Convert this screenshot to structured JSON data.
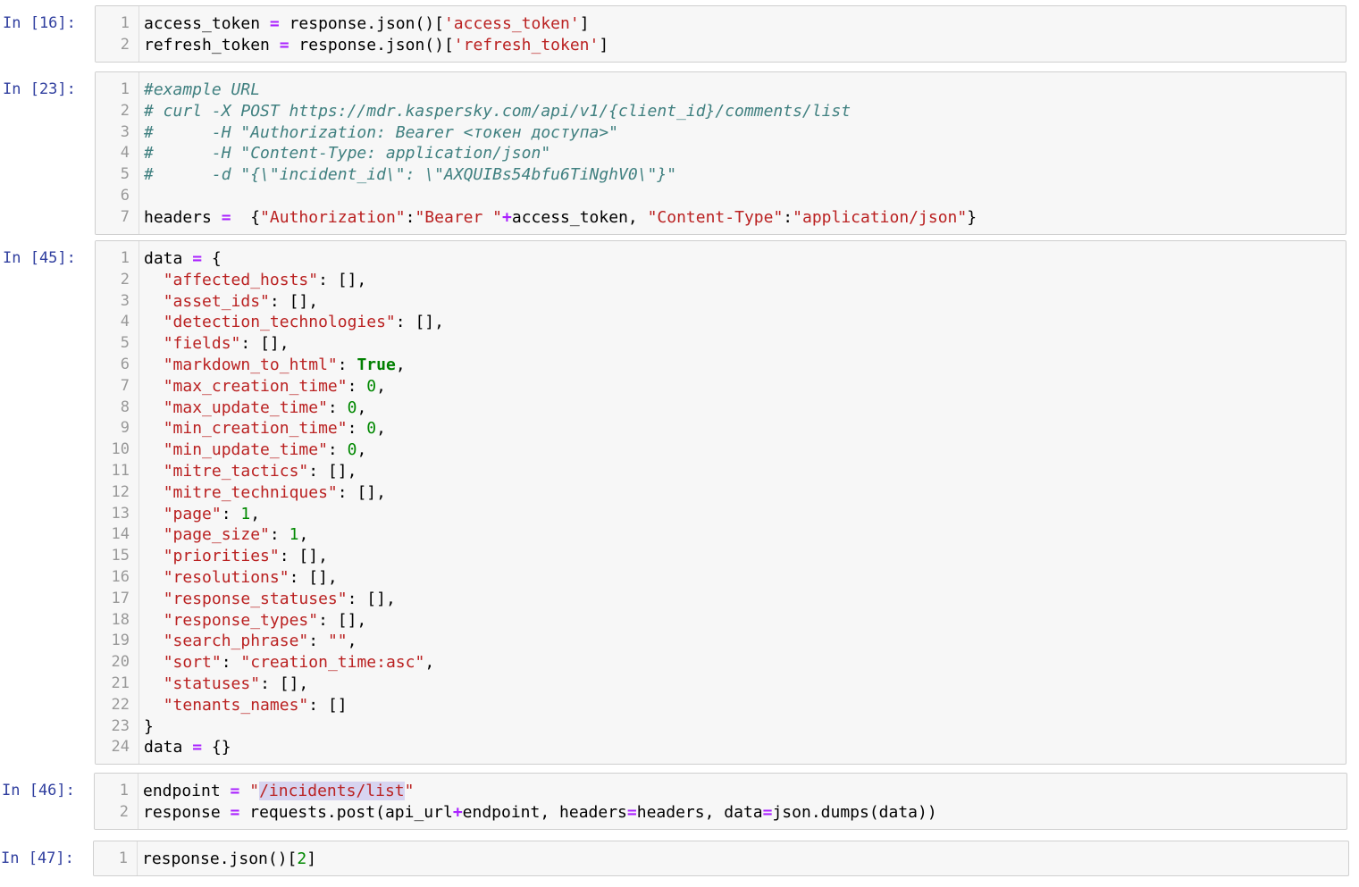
{
  "cells": [
    {
      "prompt": "In [16]:",
      "lines": [
        [
          [
            "t",
            "access_token "
          ],
          [
            "o",
            "="
          ],
          [
            "t",
            " response.json()["
          ],
          [
            "s",
            "'access_token'"
          ],
          [
            "t",
            "]"
          ]
        ],
        [
          [
            "t",
            "refresh_token "
          ],
          [
            "o",
            "="
          ],
          [
            "t",
            " response.json()["
          ],
          [
            "s",
            "'refresh_token'"
          ],
          [
            "t",
            "]"
          ]
        ]
      ]
    },
    {
      "prompt": "In [23]:",
      "lines": [
        [
          [
            "c",
            "#example URL"
          ]
        ],
        [
          [
            "c",
            "# curl -X POST https://mdr.kaspersky.com/api/v1/{client_id}/comments/list"
          ]
        ],
        [
          [
            "c",
            "#      -H \"Authorization: Bearer <токен доступа>\""
          ]
        ],
        [
          [
            "c",
            "#      -H \"Content-Type: application/json\""
          ]
        ],
        [
          [
            "c",
            "#      -d \"{\\\"incident_id\\\": \\\"AXQUIBs54bfu6TiNghV0\\\"}\""
          ]
        ],
        [],
        [
          [
            "t",
            "headers "
          ],
          [
            "o",
            "="
          ],
          [
            "t",
            "  {"
          ],
          [
            "s",
            "\"Authorization\""
          ],
          [
            "t",
            ":"
          ],
          [
            "s",
            "\"Bearer \""
          ],
          [
            "o",
            "+"
          ],
          [
            "t",
            "access_token, "
          ],
          [
            "s",
            "\"Content-Type\""
          ],
          [
            "t",
            ":"
          ],
          [
            "s",
            "\"application/json\""
          ],
          [
            "t",
            "}"
          ]
        ]
      ]
    },
    {
      "prompt": "In [45]:",
      "lines": [
        [
          [
            "t",
            "data "
          ],
          [
            "o",
            "="
          ],
          [
            "t",
            " {"
          ]
        ],
        [
          [
            "t",
            "  "
          ],
          [
            "s",
            "\"affected_hosts\""
          ],
          [
            "t",
            ": [],"
          ]
        ],
        [
          [
            "t",
            "  "
          ],
          [
            "s",
            "\"asset_ids\""
          ],
          [
            "t",
            ": [],"
          ]
        ],
        [
          [
            "t",
            "  "
          ],
          [
            "s",
            "\"detection_technologies\""
          ],
          [
            "t",
            ": [],"
          ]
        ],
        [
          [
            "t",
            "  "
          ],
          [
            "s",
            "\"fields\""
          ],
          [
            "t",
            ": [],"
          ]
        ],
        [
          [
            "t",
            "  "
          ],
          [
            "s",
            "\"markdown_to_html\""
          ],
          [
            "t",
            ": "
          ],
          [
            "k",
            "True"
          ],
          [
            "t",
            ","
          ]
        ],
        [
          [
            "t",
            "  "
          ],
          [
            "s",
            "\"max_creation_time\""
          ],
          [
            "t",
            ": "
          ],
          [
            "n",
            "0"
          ],
          [
            "t",
            ","
          ]
        ],
        [
          [
            "t",
            "  "
          ],
          [
            "s",
            "\"max_update_time\""
          ],
          [
            "t",
            ": "
          ],
          [
            "n",
            "0"
          ],
          [
            "t",
            ","
          ]
        ],
        [
          [
            "t",
            "  "
          ],
          [
            "s",
            "\"min_creation_time\""
          ],
          [
            "t",
            ": "
          ],
          [
            "n",
            "0"
          ],
          [
            "t",
            ","
          ]
        ],
        [
          [
            "t",
            "  "
          ],
          [
            "s",
            "\"min_update_time\""
          ],
          [
            "t",
            ": "
          ],
          [
            "n",
            "0"
          ],
          [
            "t",
            ","
          ]
        ],
        [
          [
            "t",
            "  "
          ],
          [
            "s",
            "\"mitre_tactics\""
          ],
          [
            "t",
            ": [],"
          ]
        ],
        [
          [
            "t",
            "  "
          ],
          [
            "s",
            "\"mitre_techniques\""
          ],
          [
            "t",
            ": [],"
          ]
        ],
        [
          [
            "t",
            "  "
          ],
          [
            "s",
            "\"page\""
          ],
          [
            "t",
            ": "
          ],
          [
            "n",
            "1"
          ],
          [
            "t",
            ","
          ]
        ],
        [
          [
            "t",
            "  "
          ],
          [
            "s",
            "\"page_size\""
          ],
          [
            "t",
            ": "
          ],
          [
            "n",
            "1"
          ],
          [
            "t",
            ","
          ]
        ],
        [
          [
            "t",
            "  "
          ],
          [
            "s",
            "\"priorities\""
          ],
          [
            "t",
            ": [],"
          ]
        ],
        [
          [
            "t",
            "  "
          ],
          [
            "s",
            "\"resolutions\""
          ],
          [
            "t",
            ": [],"
          ]
        ],
        [
          [
            "t",
            "  "
          ],
          [
            "s",
            "\"response_statuses\""
          ],
          [
            "t",
            ": [],"
          ]
        ],
        [
          [
            "t",
            "  "
          ],
          [
            "s",
            "\"response_types\""
          ],
          [
            "t",
            ": [],"
          ]
        ],
        [
          [
            "t",
            "  "
          ],
          [
            "s",
            "\"search_phrase\""
          ],
          [
            "t",
            ": "
          ],
          [
            "s",
            "\"\""
          ],
          [
            "t",
            ","
          ]
        ],
        [
          [
            "t",
            "  "
          ],
          [
            "s",
            "\"sort\""
          ],
          [
            "t",
            ": "
          ],
          [
            "s",
            "\"creation_time:asc\""
          ],
          [
            "t",
            ","
          ]
        ],
        [
          [
            "t",
            "  "
          ],
          [
            "s",
            "\"statuses\""
          ],
          [
            "t",
            ": [],"
          ]
        ],
        [
          [
            "t",
            "  "
          ],
          [
            "s",
            "\"tenants_names\""
          ],
          [
            "t",
            ": []"
          ]
        ],
        [
          [
            "t",
            "}"
          ]
        ],
        [
          [
            "t",
            "data "
          ],
          [
            "o",
            "="
          ],
          [
            "t",
            " {}"
          ]
        ]
      ]
    },
    {
      "prompt": "In [46]:",
      "lines": [
        [
          [
            "t",
            "endpoint "
          ],
          [
            "o",
            "="
          ],
          [
            "t",
            " "
          ],
          [
            "s",
            "\""
          ],
          [
            "sel",
            "/incidents/list"
          ],
          [
            "s",
            "\""
          ]
        ],
        [
          [
            "t",
            "response "
          ],
          [
            "o",
            "="
          ],
          [
            "t",
            " requests.post(api_url"
          ],
          [
            "o",
            "+"
          ],
          [
            "t",
            "endpoint, headers"
          ],
          [
            "o",
            "="
          ],
          [
            "t",
            "headers, data"
          ],
          [
            "o",
            "="
          ],
          [
            "t",
            "json.dumps(data))"
          ]
        ]
      ]
    },
    {
      "prompt": "In [47]:",
      "lines": [
        [
          [
            "t",
            "response.json()["
          ],
          [
            "n",
            "2"
          ],
          [
            "t",
            "]"
          ]
        ]
      ]
    }
  ]
}
